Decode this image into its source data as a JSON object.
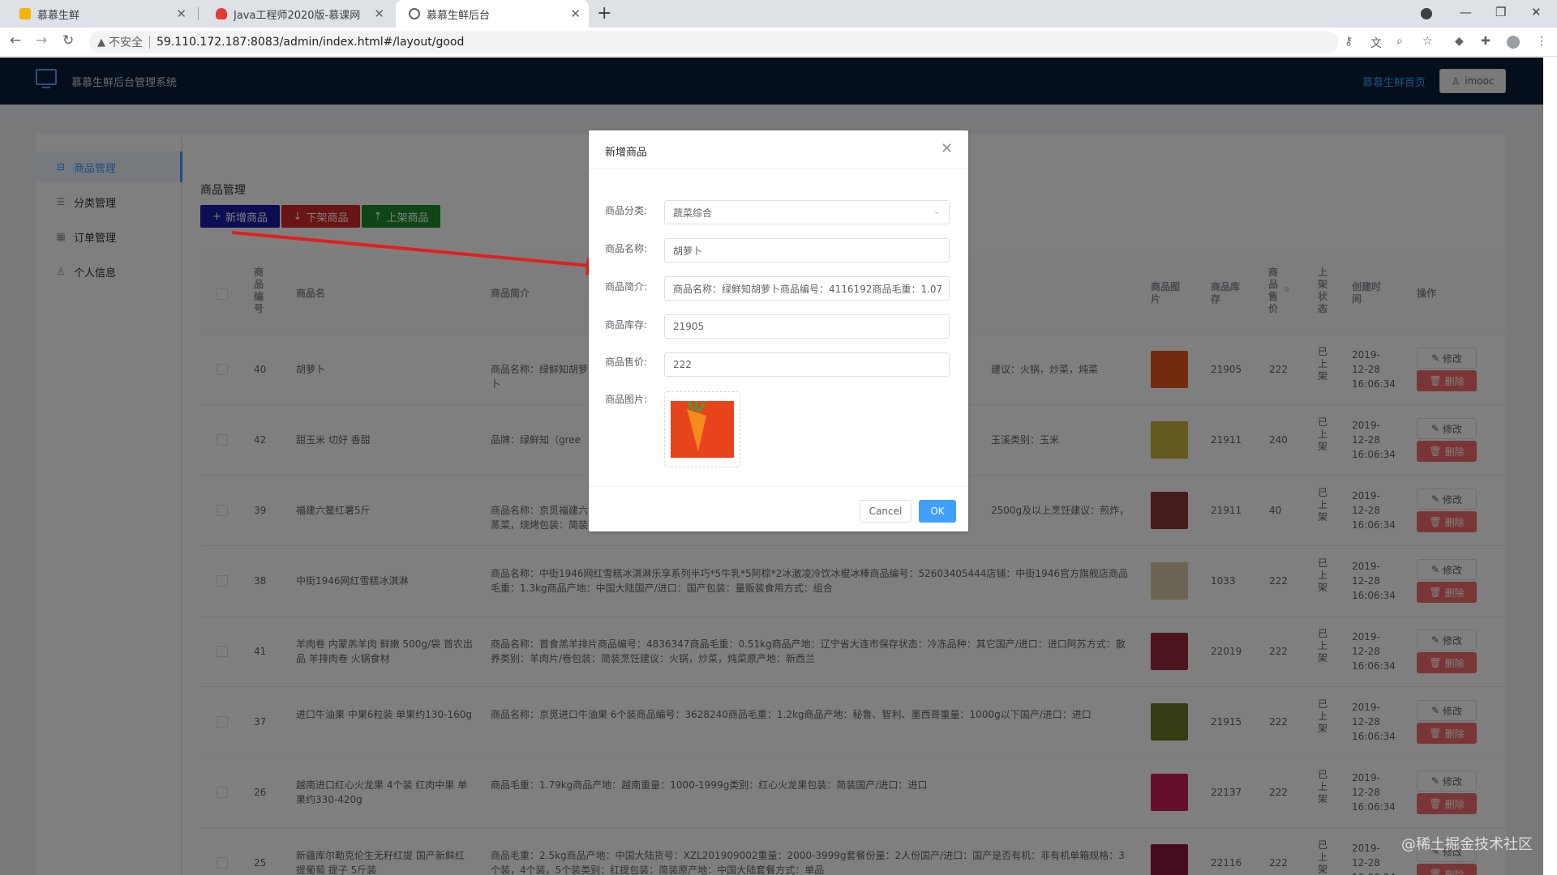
{
  "browser": {
    "tabs": [
      {
        "title": "慕慕生鲜",
        "color": "#f4b400"
      },
      {
        "title": "Java工程师2020版-慕课网",
        "color": "#e53935"
      },
      {
        "title": "慕慕生鲜后台",
        "color": "#5f6368"
      }
    ],
    "address_security": "不安全",
    "url": "59.110.172.187:8083/admin/index.html#/layout/good"
  },
  "app": {
    "title": "慕慕生鲜后台管理系统",
    "home_link": "慕慕生鲜首页",
    "user": "imooc"
  },
  "sidebar": {
    "items": [
      {
        "label": "商品管理",
        "icon": "lock-icon"
      },
      {
        "label": "分类管理",
        "icon": "list-icon"
      },
      {
        "label": "订单管理",
        "icon": "calendar-icon"
      },
      {
        "label": "个人信息",
        "icon": "user-icon"
      }
    ]
  },
  "page": {
    "section_title": "商品管理",
    "toolbar": {
      "add": "新增商品",
      "off_shelf": "下架商品",
      "on_shelf": "上架商品",
      "add_color": "#1a1aa6",
      "off_color": "#d42828",
      "on_color": "#1c8c2c"
    }
  },
  "table": {
    "headers": {
      "id": "商品编号",
      "name": "商品名",
      "desc": "商品简介",
      "image": "商品图片",
      "stock": "商品库存",
      "price": "商品售价",
      "status": "上架状态",
      "created": "创建时间",
      "ops": "操作"
    },
    "edit_label": "修改",
    "delete_label": "删除",
    "rows": [
      {
        "id": "40",
        "name": "胡萝卜",
        "desc": "商品名称：绿鲜知胡萝卜",
        "desc_right": "建议：火锅，炒菜，炖菜",
        "stock": "21905",
        "price": "222",
        "status": "已上架",
        "date": "2019-12-28",
        "time": "16:06:34",
        "img": "#e8541e"
      },
      {
        "id": "42",
        "name": "甜玉米 切好 香甜",
        "desc": "品牌：绿鲜知（gree",
        "desc_right": "玉溪类别：玉米",
        "stock": "21911",
        "price": "240",
        "status": "已上架",
        "date": "2019-12-28",
        "time": "16:06:34",
        "img": "#c8b43a"
      },
      {
        "id": "39",
        "name": "福建六鳌红薯5斤",
        "desc": "商品名称：京觅福建六\n蒸菜，烧烤包装：简装",
        "desc_right": "2500g及以上烹饪建议：煎炸，",
        "stock": "21911",
        "price": "40",
        "status": "已上架",
        "date": "2019-12-28",
        "time": "16:06:34",
        "img": "#8a3a3a"
      },
      {
        "id": "38",
        "name": "中街1946网红雪糕冰淇淋",
        "desc": "商品名称：中街1946网红雪糕冰淇淋乐享系列半巧*5牛乳*5阿棕*2冰激凌冷饮冰棍冰棒商品编号：52603405444店铺：中街1946官方旗舰店商品毛重：1.3kg商品产地：中国大陆国产/进口：国产包装：量贩装食用方式：组合",
        "desc_right": "",
        "stock": "1033",
        "price": "222",
        "status": "已上架",
        "date": "2019-12-28",
        "time": "16:06:34",
        "img": "#d9c8a8"
      },
      {
        "id": "41",
        "name": "羊肉卷 内蒙羔羊肉 鲜嫩 500g/袋 首农出品 羊排肉卷 火锅食材",
        "desc": "商品名称：首食羔羊排片商品编号：4836347商品毛重：0.51kg商品产地：辽宁省大连市保存状态：冷冻品种：其它国产/进口：进口阿苏方式：散养类别：羊肉片/卷包装：简装烹饪建议：火锅，炒菜，炖菜原产地：新西兰",
        "desc_right": "",
        "stock": "22019",
        "price": "222",
        "status": "已上架",
        "date": "2019-12-28",
        "time": "16:06:34",
        "img": "#9a2a3a"
      },
      {
        "id": "37",
        "name": "进口牛油果 中果6粒装 单果约130-160g",
        "desc": "商品名称：京觅进口牛油果 6个装商品编号：3628240商品毛重：1.2kg商品产地：秘鲁、智利、墨西哥重量：1000g以下国产/进口：进口",
        "desc_right": "",
        "stock": "21915",
        "price": "222",
        "status": "已上架",
        "date": "2019-12-28",
        "time": "16:06:34",
        "img": "#6a7a2a"
      },
      {
        "id": "26",
        "name": "越南进口红心火龙果 4个装 红肉中果 单果约330-420g",
        "desc": "商品毛重：1.79kg商品产地：越南重量：1000-1999g类别：红心火龙果包装：简装国产/进口：进口",
        "desc_right": "",
        "stock": "22137",
        "price": "222",
        "status": "已上架",
        "date": "2019-12-28",
        "time": "16:06:34",
        "img": "#c8205a"
      },
      {
        "id": "25",
        "name": "新疆库尔勒克伦生无籽红提 国产新鲜红提葡萄 提子 5斤装",
        "desc": "商品毛重：2.5kg商品产地：中国大陆货号：XZL201909002重量：2000-3999g套餐份量：2人份国产/进口：国产是否有机：非有机单箱规格：3个装，4个装，5个装类别：红提包装：简装原产地：中国大陆套餐方式：单品",
        "desc_right": "",
        "stock": "22116",
        "price": "222",
        "status": "已上架",
        "date": "2019-12-28",
        "time": "16:06:34",
        "img": "#8a1a3a"
      }
    ]
  },
  "dialog": {
    "title": "新增商品",
    "category_label": "商品分类:",
    "category_value": "蔬菜综合",
    "name_label": "商品名称:",
    "name_value": "胡萝卜",
    "desc_label": "商品简介:",
    "desc_value": "商品名称：绿鲜知胡萝卜商品编号：4116192商品毛重：1.07",
    "stock_label": "商品库存:",
    "stock_value": "21905",
    "price_label": "商品售价:",
    "price_value": "222",
    "image_label": "商品图片:",
    "cancel": "Cancel",
    "ok": "OK"
  },
  "watermark": "@稀土掘金技术社区"
}
